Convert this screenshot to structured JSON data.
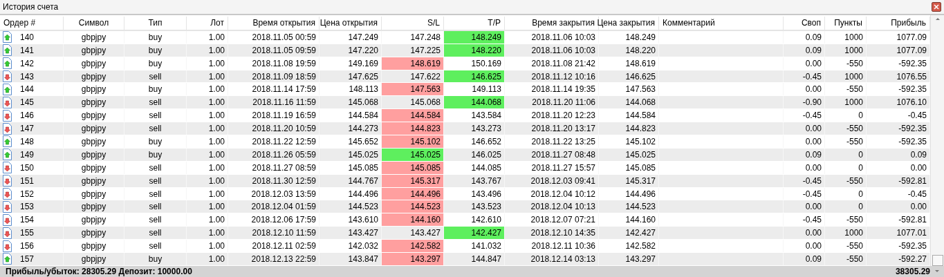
{
  "window": {
    "title": "История счета"
  },
  "table": {
    "columns": [
      "Ордер #",
      "Символ",
      "Тип",
      "Лот",
      "Время открытия",
      "Цена открытия",
      "S/L",
      "T/P",
      "Время закрытия",
      "Цена закрытия",
      "Комментарий",
      "Своп",
      "Пункты",
      "Прибыль"
    ],
    "rows": [
      {
        "kind": "long",
        "order": "140",
        "symbol": "gbpjpy",
        "type": "buy",
        "lot": "1.00",
        "open_time": "2018.11.05 00:59",
        "open_price": "147.249",
        "sl": {
          "value": "147.248"
        },
        "tp": {
          "value": "148.249",
          "color": "#5eef5e"
        },
        "close_time": "2018.11.06 10:03",
        "close_price": "148.249",
        "swap": "0.09",
        "points": "1000",
        "profit": "1077.09"
      },
      {
        "kind": "long",
        "order": "141",
        "symbol": "gbpjpy",
        "type": "buy",
        "lot": "1.00",
        "open_time": "2018.11.05 09:59",
        "open_price": "147.220",
        "sl": {
          "value": "147.225"
        },
        "tp": {
          "value": "148.220",
          "color": "#5eef5e"
        },
        "close_time": "2018.11.06 10:03",
        "close_price": "148.220",
        "swap": "0.09",
        "points": "1000",
        "profit": "1077.09"
      },
      {
        "kind": "long",
        "order": "142",
        "symbol": "gbpjpy",
        "type": "buy",
        "lot": "1.00",
        "open_time": "2018.11.08 19:59",
        "open_price": "149.169",
        "sl": {
          "value": "148.619",
          "color": "#ff9f9f"
        },
        "tp": {
          "value": "150.169"
        },
        "close_time": "2018.11.08 21:42",
        "close_price": "148.619",
        "swap": "0.00",
        "points": "-550",
        "profit": "-592.35"
      },
      {
        "kind": "short",
        "order": "143",
        "symbol": "gbpjpy",
        "type": "sell",
        "lot": "1.00",
        "open_time": "2018.11.09 18:59",
        "open_price": "147.625",
        "sl": {
          "value": "147.622"
        },
        "tp": {
          "value": "146.625",
          "color": "#5eef5e"
        },
        "close_time": "2018.11.12 10:16",
        "close_price": "146.625",
        "swap": "-0.45",
        "points": "1000",
        "profit": "1076.55"
      },
      {
        "kind": "long",
        "order": "144",
        "symbol": "gbpjpy",
        "type": "buy",
        "lot": "1.00",
        "open_time": "2018.11.14 17:59",
        "open_price": "148.113",
        "sl": {
          "value": "147.563",
          "color": "#ff9f9f"
        },
        "tp": {
          "value": "149.113"
        },
        "close_time": "2018.11.14 19:35",
        "close_price": "147.563",
        "swap": "0.00",
        "points": "-550",
        "profit": "-592.35"
      },
      {
        "kind": "short",
        "order": "145",
        "symbol": "gbpjpy",
        "type": "sell",
        "lot": "1.00",
        "open_time": "2018.11.16 11:59",
        "open_price": "145.068",
        "sl": {
          "value": "145.068"
        },
        "tp": {
          "value": "144.068",
          "color": "#5eef5e"
        },
        "close_time": "2018.11.20 11:06",
        "close_price": "144.068",
        "swap": "-0.90",
        "points": "1000",
        "profit": "1076.10"
      },
      {
        "kind": "short",
        "order": "146",
        "symbol": "gbpjpy",
        "type": "sell",
        "lot": "1.00",
        "open_time": "2018.11.19 16:59",
        "open_price": "144.584",
        "sl": {
          "value": "144.584",
          "color": "#ff9f9f"
        },
        "tp": {
          "value": "143.584"
        },
        "close_time": "2018.11.20 12:23",
        "close_price": "144.584",
        "swap": "-0.45",
        "points": "0",
        "profit": "-0.45"
      },
      {
        "kind": "short",
        "order": "147",
        "symbol": "gbpjpy",
        "type": "sell",
        "lot": "1.00",
        "open_time": "2018.11.20 10:59",
        "open_price": "144.273",
        "sl": {
          "value": "144.823",
          "color": "#ff9f9f"
        },
        "tp": {
          "value": "143.273"
        },
        "close_time": "2018.11.20 13:17",
        "close_price": "144.823",
        "swap": "0.00",
        "points": "-550",
        "profit": "-592.35"
      },
      {
        "kind": "long",
        "order": "148",
        "symbol": "gbpjpy",
        "type": "buy",
        "lot": "1.00",
        "open_time": "2018.11.22 12:59",
        "open_price": "145.652",
        "sl": {
          "value": "145.102",
          "color": "#ff9f9f"
        },
        "tp": {
          "value": "146.652"
        },
        "close_time": "2018.11.22 13:25",
        "close_price": "145.102",
        "swap": "0.00",
        "points": "-550",
        "profit": "-592.35"
      },
      {
        "kind": "long",
        "order": "149",
        "symbol": "gbpjpy",
        "type": "buy",
        "lot": "1.00",
        "open_time": "2018.11.26 05:59",
        "open_price": "145.025",
        "sl": {
          "value": "145.025",
          "color": "#5eef5e"
        },
        "tp": {
          "value": "146.025"
        },
        "close_time": "2018.11.27 08:48",
        "close_price": "145.025",
        "swap": "0.09",
        "points": "0",
        "profit": "0.09"
      },
      {
        "kind": "short",
        "order": "150",
        "symbol": "gbpjpy",
        "type": "sell",
        "lot": "1.00",
        "open_time": "2018.11.27 08:59",
        "open_price": "145.085",
        "sl": {
          "value": "145.085",
          "color": "#ff9f9f"
        },
        "tp": {
          "value": "144.085"
        },
        "close_time": "2018.11.27 15:57",
        "close_price": "145.085",
        "swap": "0.00",
        "points": "0",
        "profit": "0.00"
      },
      {
        "kind": "short",
        "order": "151",
        "symbol": "gbpjpy",
        "type": "sell",
        "lot": "1.00",
        "open_time": "2018.11.30 12:59",
        "open_price": "144.767",
        "sl": {
          "value": "145.317",
          "color": "#ff9f9f"
        },
        "tp": {
          "value": "143.767"
        },
        "close_time": "2018.12.03 09:41",
        "close_price": "145.317",
        "swap": "-0.45",
        "points": "-550",
        "profit": "-592.81"
      },
      {
        "kind": "short",
        "order": "152",
        "symbol": "gbpjpy",
        "type": "sell",
        "lot": "1.00",
        "open_time": "2018.12.03 13:59",
        "open_price": "144.496",
        "sl": {
          "value": "144.496",
          "color": "#ff9f9f"
        },
        "tp": {
          "value": "143.496"
        },
        "close_time": "2018.12.04 10:12",
        "close_price": "144.496",
        "swap": "-0.45",
        "points": "0",
        "profit": "-0.45"
      },
      {
        "kind": "short",
        "order": "153",
        "symbol": "gbpjpy",
        "type": "sell",
        "lot": "1.00",
        "open_time": "2018.12.04 01:59",
        "open_price": "144.523",
        "sl": {
          "value": "144.523",
          "color": "#ff9f9f"
        },
        "tp": {
          "value": "143.523"
        },
        "close_time": "2018.12.04 10:13",
        "close_price": "144.523",
        "swap": "0.00",
        "points": "0",
        "profit": "0.00"
      },
      {
        "kind": "short",
        "order": "154",
        "symbol": "gbpjpy",
        "type": "sell",
        "lot": "1.00",
        "open_time": "2018.12.06 17:59",
        "open_price": "143.610",
        "sl": {
          "value": "144.160",
          "color": "#ff9f9f"
        },
        "tp": {
          "value": "142.610"
        },
        "close_time": "2018.12.07 07:21",
        "close_price": "144.160",
        "swap": "-0.45",
        "points": "-550",
        "profit": "-592.81"
      },
      {
        "kind": "short",
        "order": "155",
        "symbol": "gbpjpy",
        "type": "sell",
        "lot": "1.00",
        "open_time": "2018.12.10 11:59",
        "open_price": "143.427",
        "sl": {
          "value": "143.427"
        },
        "tp": {
          "value": "142.427",
          "color": "#5eef5e"
        },
        "close_time": "2018.12.10 14:35",
        "close_price": "142.427",
        "swap": "0.00",
        "points": "1000",
        "profit": "1077.01"
      },
      {
        "kind": "short",
        "order": "156",
        "symbol": "gbpjpy",
        "type": "sell",
        "lot": "1.00",
        "open_time": "2018.12.11 02:59",
        "open_price": "142.032",
        "sl": {
          "value": "142.582",
          "color": "#ff9f9f"
        },
        "tp": {
          "value": "141.032"
        },
        "close_time": "2018.12.11 10:36",
        "close_price": "142.582",
        "swap": "0.00",
        "points": "-550",
        "profit": "-592.35"
      },
      {
        "kind": "long",
        "order": "157",
        "symbol": "gbpjpy",
        "type": "buy",
        "lot": "1.00",
        "open_time": "2018.12.13 22:59",
        "open_price": "143.847",
        "sl": {
          "value": "143.297",
          "color": "#ff9f9f"
        },
        "tp": {
          "value": "144.847"
        },
        "close_time": "2018.12.14 03:13",
        "close_price": "143.297",
        "swap": "0.09",
        "points": "-550",
        "profit": "-592.27"
      }
    ]
  },
  "summary": {
    "text": "Прибыль/убыток: 28305.29 Депозит: 10000.00",
    "total": "38305.29"
  }
}
